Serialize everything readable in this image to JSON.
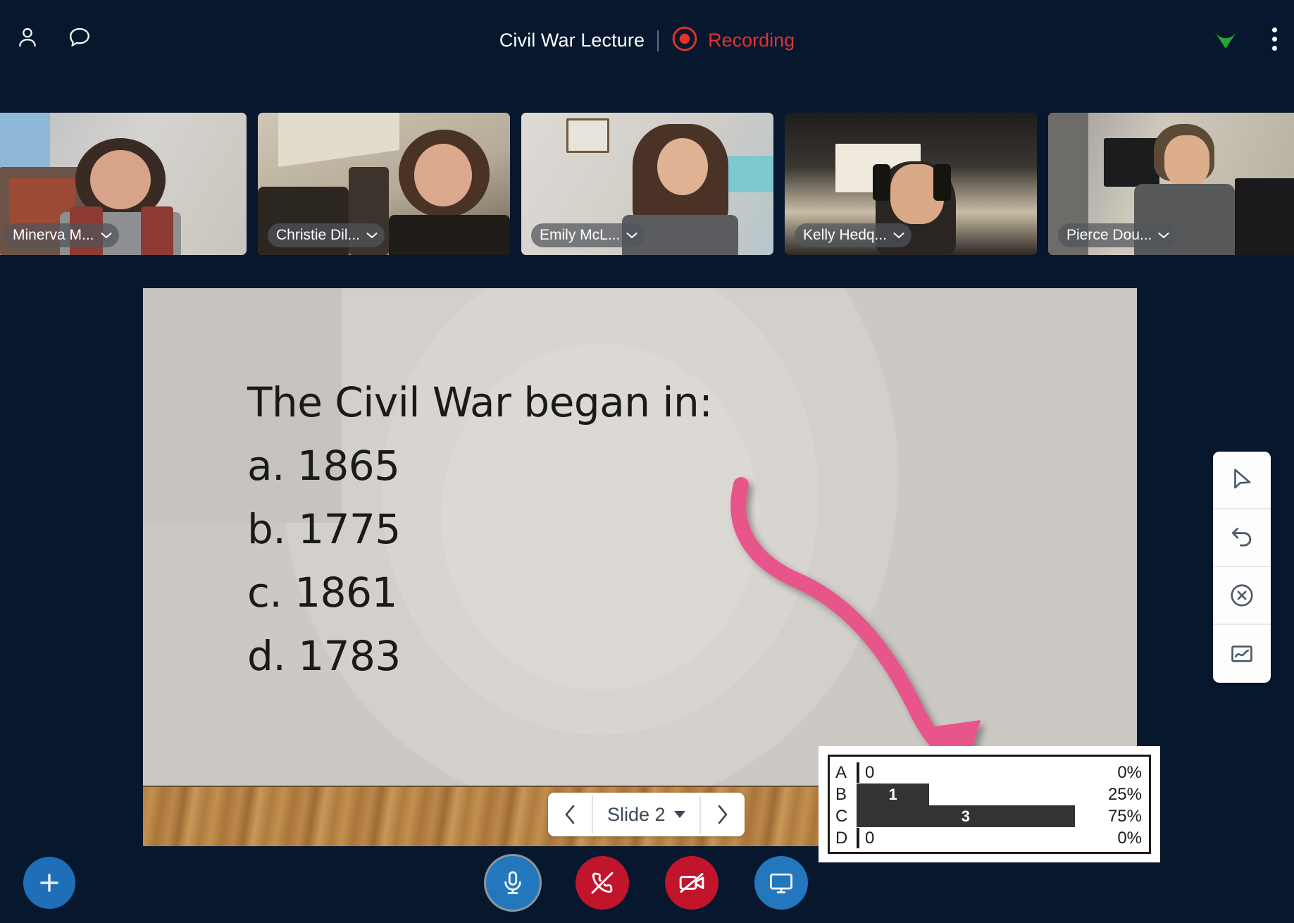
{
  "header": {
    "title": "Civil War Lecture",
    "recording_label": "Recording",
    "participants_icon": "person-icon",
    "chat_icon": "chat-bubble-icon",
    "signal_icon": "signal-strength-icon",
    "signal_color": "#22a637",
    "menu_icon": "overflow-menu-icon",
    "recording_color": "#e8312c",
    "record_dot_icon": "record-dot-icon"
  },
  "participants": [
    {
      "name": "Minerva M...",
      "caret": "chevron-down-icon"
    },
    {
      "name": "Christie Dil...",
      "caret": "chevron-down-icon"
    },
    {
      "name": "Emily McL...",
      "caret": "chevron-down-icon"
    },
    {
      "name": "Kelly Hedq...",
      "caret": "chevron-down-icon"
    },
    {
      "name": "Pierce Dou...",
      "caret": "chevron-down-icon"
    }
  ],
  "slide": {
    "question": "The Civil War began in:",
    "options": [
      "a. 1865",
      "b. 1775",
      "c. 1861",
      "d. 1783"
    ]
  },
  "poll": {
    "rows": [
      {
        "letter": "A",
        "count": "0",
        "percent": "0%",
        "pct_value": 0
      },
      {
        "letter": "B",
        "count": "1",
        "percent": "25%",
        "pct_value": 25
      },
      {
        "letter": "C",
        "count": "3",
        "percent": "75%",
        "pct_value": 75
      },
      {
        "letter": "D",
        "count": "0",
        "percent": "0%",
        "pct_value": 0
      }
    ]
  },
  "chart_data": {
    "type": "bar",
    "title": "Poll results",
    "categories": [
      "A",
      "B",
      "C",
      "D"
    ],
    "values": [
      0,
      1,
      3,
      0
    ],
    "percents": [
      0,
      25,
      75,
      0
    ],
    "xlabel": "",
    "ylabel": "",
    "ylim": [
      0,
      4
    ],
    "orientation": "horizontal",
    "grid": false,
    "legend": "none",
    "bar_color": "#333333"
  },
  "annotation": {
    "type": "arrow",
    "color": "#e8548a",
    "description": "curved pink arrow pointing to poll results"
  },
  "slide_nav": {
    "prev_icon": "chevron-left-icon",
    "next_icon": "chevron-right-icon",
    "label": "Slide 2",
    "caret": "caret-down-icon"
  },
  "toolbar": {
    "tools": [
      {
        "icon": "pointer-cursor-icon",
        "name": "pointer-tool"
      },
      {
        "icon": "undo-arrow-icon",
        "name": "undo-tool"
      },
      {
        "icon": "clear-circle-x-icon",
        "name": "clear-tool"
      },
      {
        "icon": "line-chart-icon",
        "name": "poll-chart-tool"
      }
    ]
  },
  "controls": {
    "add_label": "+",
    "buttons": [
      {
        "name": "microphone-button",
        "icon": "microphone-icon",
        "color": "#2277bd",
        "state": "active"
      },
      {
        "name": "end-call-button",
        "icon": "phone-hangup-icon",
        "color": "#c0152b",
        "state": "off"
      },
      {
        "name": "camera-button",
        "icon": "video-camera-off-icon",
        "color": "#c0152b",
        "state": "off"
      },
      {
        "name": "share-screen-button",
        "icon": "monitor-share-icon",
        "color": "#2277bd",
        "state": "on"
      }
    ]
  }
}
